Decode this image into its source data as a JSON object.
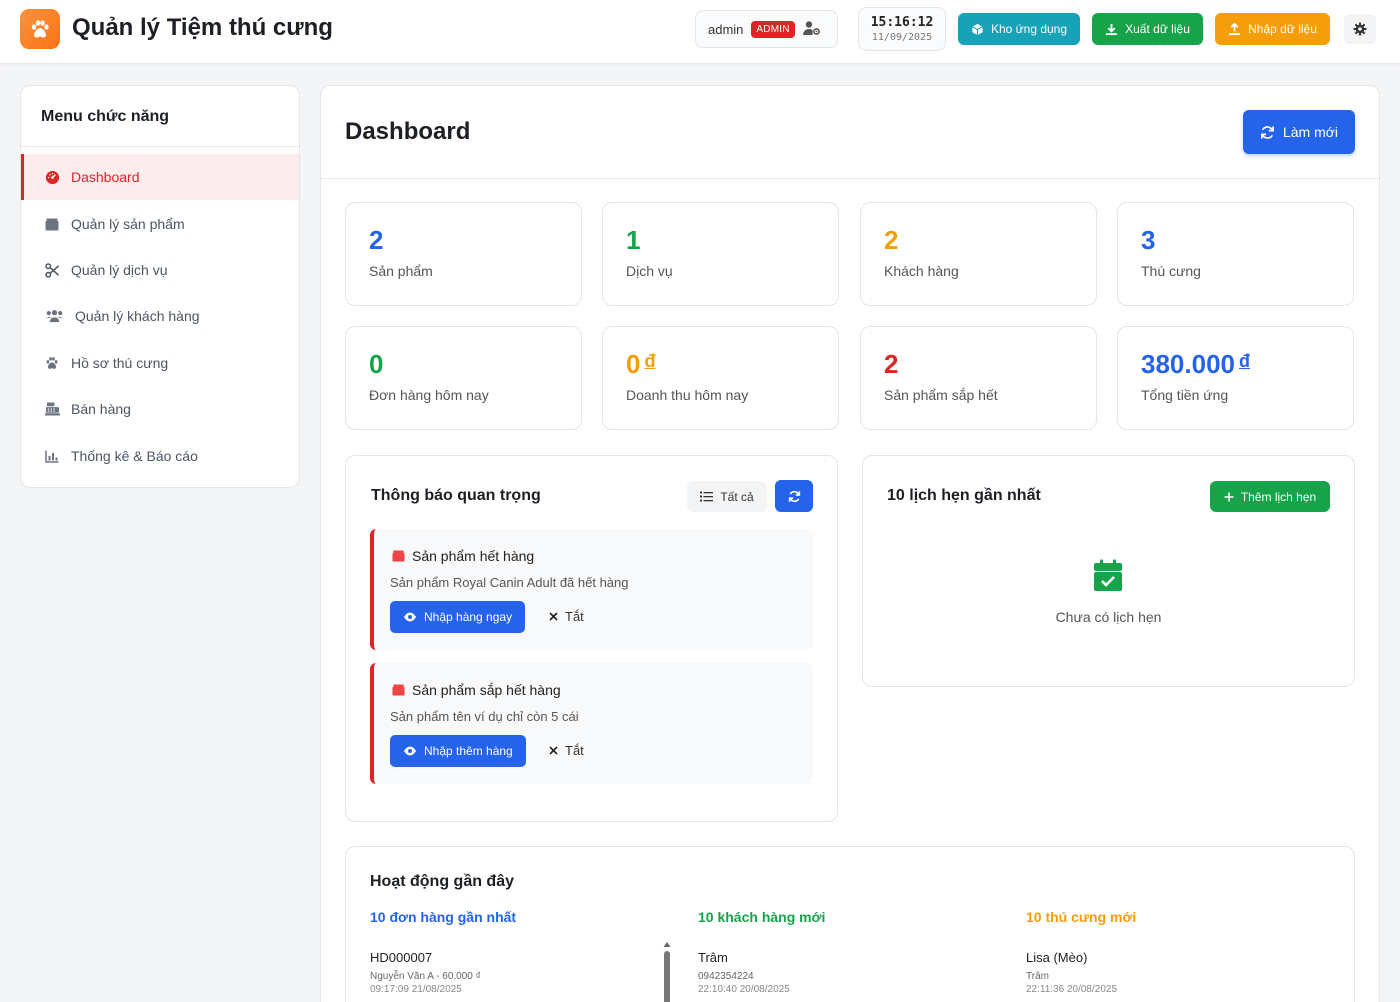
{
  "header": {
    "title": "Quản lý Tiệm thú cưng",
    "user": "admin",
    "role_badge": "ADMIN",
    "time": "15:16:12",
    "date": "11/09/2025",
    "buttons": {
      "apps": "Kho ứng dụng",
      "export": "Xuất dữ liệu",
      "import": "Nhập dữ liệu"
    }
  },
  "sidebar": {
    "title": "Menu chức năng",
    "items": [
      {
        "label": "Dashboard",
        "icon": "dashboard-icon"
      },
      {
        "label": "Quản lý sản phẩm",
        "icon": "box-icon"
      },
      {
        "label": "Quản lý dịch vụ",
        "icon": "scissors-icon"
      },
      {
        "label": "Quản lý khách hàng",
        "icon": "users-icon"
      },
      {
        "label": "Hồ sơ thú cưng",
        "icon": "paw-icon"
      },
      {
        "label": "Bán hàng",
        "icon": "cash-register-icon"
      },
      {
        "label": "Thống kê & Báo cáo",
        "icon": "chart-icon"
      }
    ]
  },
  "main": {
    "title": "Dashboard",
    "refresh_label": "Làm mới",
    "stats": [
      {
        "value": "2",
        "currency": "",
        "label": "Sản phẩm",
        "color": "#2563eb"
      },
      {
        "value": "1",
        "currency": "",
        "label": "Dịch vụ",
        "color": "#16a34a"
      },
      {
        "value": "2",
        "currency": "",
        "label": "Khách hàng",
        "color": "#f59e0b"
      },
      {
        "value": "3",
        "currency": "",
        "label": "Thú cưng",
        "color": "#2563eb"
      },
      {
        "value": "0",
        "currency": "",
        "label": "Đơn hàng hôm nay",
        "color": "#16a34a"
      },
      {
        "value": "0",
        "currency": "đ",
        "label": "Doanh thu hôm nay",
        "color": "#f59e0b"
      },
      {
        "value": "2",
        "currency": "",
        "label": "Sản phẩm sắp hết",
        "color": "#dc2626"
      },
      {
        "value": "380.000",
        "currency": "đ",
        "label": "Tổng tiền ứng",
        "color": "#2563eb"
      }
    ],
    "notifications": {
      "title": "Thông báo quan trọng",
      "all_label": "Tất cả",
      "items": [
        {
          "title": "Sản phẩm hết hàng",
          "desc": "Sản phẩm Royal Canin Adult đã hết hàng",
          "action": "Nhập hàng ngay",
          "dismiss": "Tắt"
        },
        {
          "title": "Sản phẩm sắp hết hàng",
          "desc": "Sản phẩm tên ví dụ chỉ còn 5 cái",
          "action": "Nhập thêm hàng",
          "dismiss": "Tắt"
        }
      ]
    },
    "appointments": {
      "title": "10 lịch hẹn gần nhất",
      "add_label": "Thêm lịch hẹn",
      "empty_text": "Chưa có lịch hẹn"
    },
    "activity": {
      "title": "Hoạt động gần đây",
      "columns": [
        {
          "heading": "10 đơn hàng gần nhất",
          "color": "#2563eb",
          "item": {
            "primary": "HD000007",
            "secondary": "Nguyễn Văn A - 60.000 ₫",
            "time": "09:17:09 21/08/2025"
          }
        },
        {
          "heading": "10 khách hàng mới",
          "color": "#16a34a",
          "item": {
            "primary": "Trâm",
            "secondary": "0942354224",
            "time": "22:10:40 20/08/2025"
          }
        },
        {
          "heading": "10 thú cưng mới",
          "color": "#f59e0b",
          "item": {
            "primary": "Lisa (Mèo)",
            "secondary": "Trâm",
            "time": "22:11:36 20/08/2025"
          }
        }
      ]
    }
  }
}
